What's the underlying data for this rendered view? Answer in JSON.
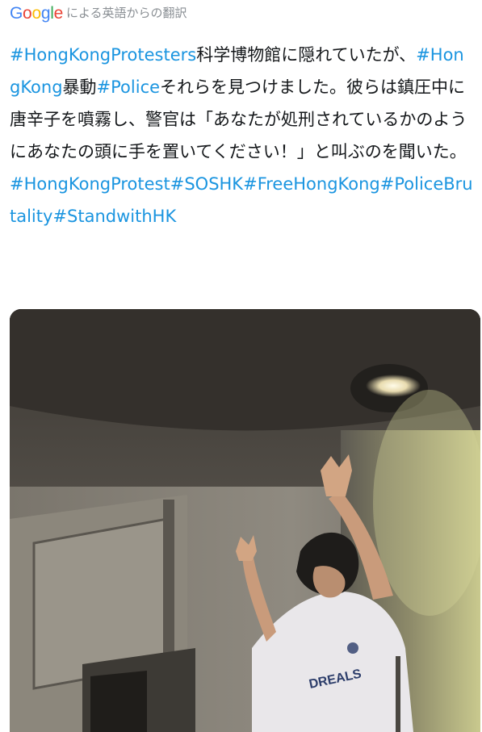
{
  "translate": {
    "logo_letters": [
      {
        "char": "G",
        "color": "#4285F4"
      },
      {
        "char": "o",
        "color": "#EA4335"
      },
      {
        "char": "o",
        "color": "#FBBC05"
      },
      {
        "char": "g",
        "color": "#4285F4"
      },
      {
        "char": "l",
        "color": "#34A853"
      },
      {
        "char": "e",
        "color": "#EA4335"
      }
    ],
    "label": "による英語からの翻訳"
  },
  "tweet": {
    "segments": [
      {
        "text": "#HongKongProtesters",
        "type": "hashtag"
      },
      {
        "text": "科学博物館に隠れていたが、",
        "type": "text"
      },
      {
        "text": "#HongKong",
        "type": "hashtag"
      },
      {
        "text": "暴動",
        "type": "text"
      },
      {
        "text": "#Police",
        "type": "hashtag"
      },
      {
        "text": "それらを見つけました。彼らは鎮圧中に唐辛子を噴霧し、警官は「あなたが処刑されているかのようにあなたの頭に手を置いてください！」と叫ぶのを聞いた。",
        "type": "text"
      },
      {
        "text": "#HongKongProtest",
        "type": "hashtag"
      },
      {
        "text": "#SOSHK",
        "type": "hashtag"
      },
      {
        "text": "#FreeHongKong",
        "type": "hashtag"
      },
      {
        "text": "#PoliceBrutality",
        "type": "hashtag"
      },
      {
        "text": "#StandwithHK",
        "type": "hashtag"
      }
    ],
    "colors": {
      "text": "#14171a",
      "hashtag": "#1b95e0"
    }
  },
  "media": {
    "type": "video-still",
    "shirt_text": "DREALS"
  }
}
